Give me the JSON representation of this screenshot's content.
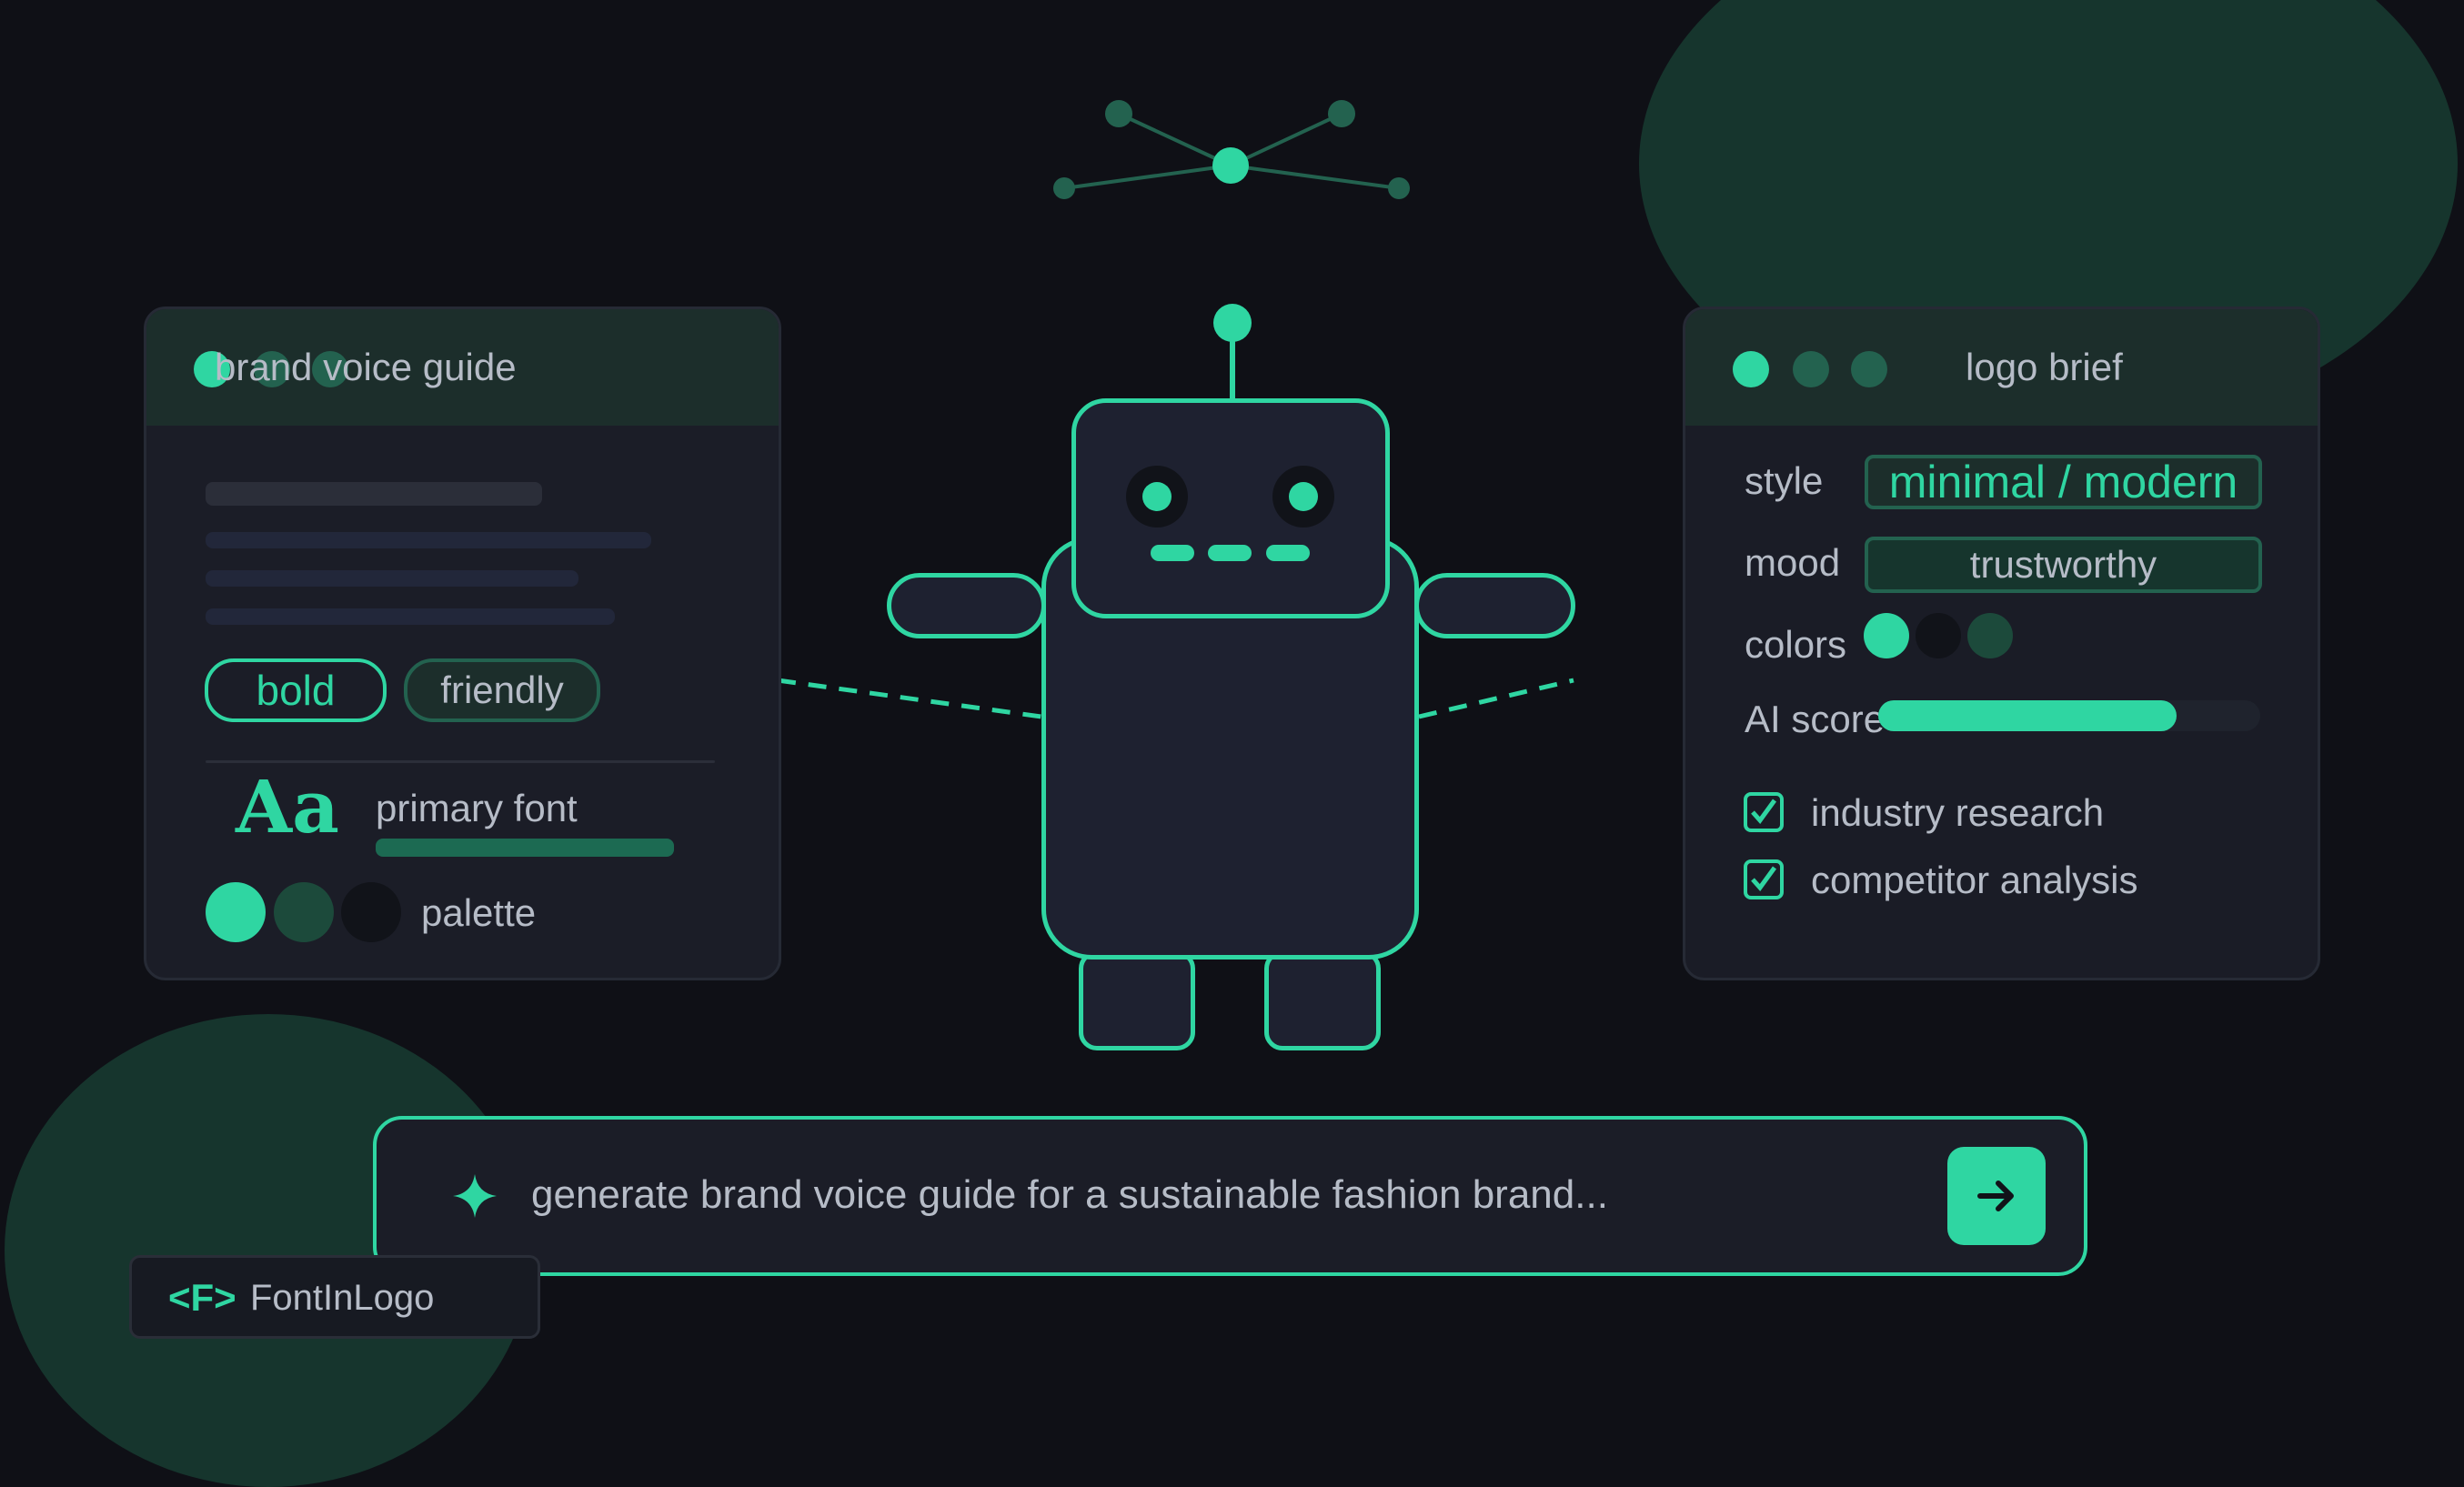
{
  "colors": {
    "accent": "#2fd6a2",
    "dark_green": "#23624f",
    "muted_green": "#1c4a3b",
    "text": "#b6bcc7",
    "background": "#0f1016"
  },
  "left_card": {
    "title": "brand voice guide",
    "tags": [
      "bold",
      "friendly"
    ],
    "font_sample": "Aa",
    "font_label": "primary font",
    "palette_label": "palette"
  },
  "right_card": {
    "title": "logo brief",
    "style_label": "style",
    "style_value": "minimal / modern",
    "mood_label": "mood",
    "mood_value": "trustworthy",
    "colors_label": "colors",
    "ai_score_label": "AI score",
    "ai_score_fraction": 0.78,
    "checklist": [
      "industry research",
      "competitor analysis"
    ]
  },
  "prompt": {
    "icon": "sparkle-icon",
    "text": "generate brand voice guide for a sustainable fashion brand...",
    "send_icon": "arrow-right-icon"
  },
  "brand": {
    "mark": "<F>",
    "name": "FontInLogo"
  }
}
